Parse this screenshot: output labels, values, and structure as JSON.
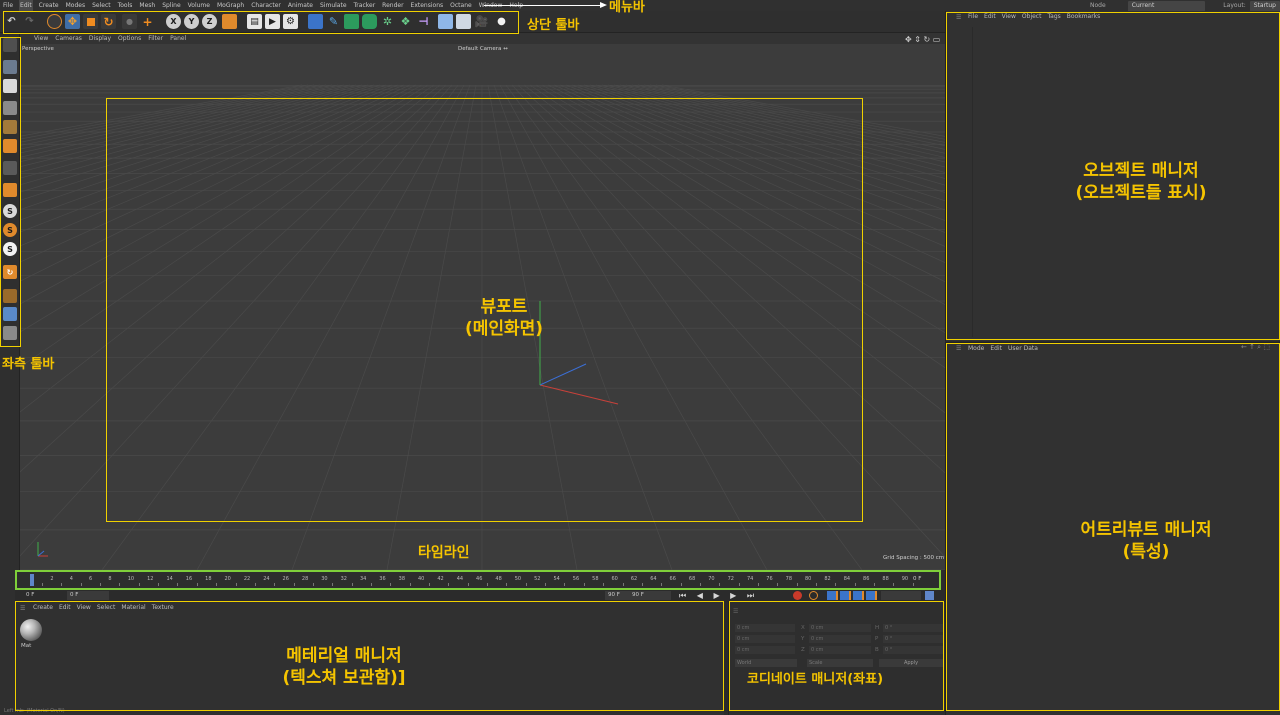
{
  "menubar": {
    "items": [
      "File",
      "Edit",
      "Create",
      "Modes",
      "Select",
      "Tools",
      "Mesh",
      "Spline",
      "Volume",
      "MoGraph",
      "Character",
      "Animate",
      "Simulate",
      "Tracker",
      "Render",
      "Extensions",
      "Octane",
      "Window",
      "Help"
    ],
    "node_space_label": "Node Space:",
    "node_space_value": "Current (Standard/Physical)",
    "layout_label": "Layout:",
    "layout_value": "Startup"
  },
  "toolbar": {
    "axis_x": "X",
    "axis_y": "Y",
    "axis_z": "Z"
  },
  "viewport": {
    "menu": [
      "View",
      "Cameras",
      "Display",
      "Options",
      "Filter",
      "Panel"
    ],
    "mode_label": "Perspective",
    "camera_label": "Default Camera ↔",
    "grid_spacing": "Grid Spacing : 500 cm"
  },
  "timeline": {
    "ticks": [
      "0",
      "2",
      "4",
      "6",
      "8",
      "10",
      "12",
      "14",
      "16",
      "18",
      "20",
      "22",
      "24",
      "26",
      "28",
      "30",
      "32",
      "34",
      "36",
      "38",
      "40",
      "42",
      "44",
      "46",
      "48",
      "50",
      "52",
      "54",
      "56",
      "58",
      "60",
      "62",
      "64",
      "66",
      "68",
      "70",
      "72",
      "74",
      "76",
      "78",
      "80",
      "82",
      "84",
      "86",
      "88",
      "90"
    ],
    "end_frame": "0 F",
    "start_field": "0 F",
    "current_field": "0 F",
    "max_field": "90 F",
    "max_field2": "90 F"
  },
  "material_manager": {
    "menu": [
      "Create",
      "Edit",
      "View",
      "Select",
      "Material",
      "Texture"
    ],
    "material_name": "Mat"
  },
  "coordinate_manager": {
    "rows": [
      {
        "axis": "X",
        "pos": "0 cm",
        "size": "0 cm",
        "rot_label": "H",
        "rot": "0 °"
      },
      {
        "axis": "Y",
        "pos": "0 cm",
        "size": "0 cm",
        "rot_label": "P",
        "rot": "0 °"
      },
      {
        "axis": "Z",
        "pos": "0 cm",
        "size": "0 cm",
        "rot_label": "B",
        "rot": "0 °"
      }
    ],
    "world_select": "World",
    "scale_select": "Scale",
    "apply_label": "Apply"
  },
  "object_manager": {
    "menu": [
      "File",
      "Edit",
      "View",
      "Object",
      "Tags",
      "Bookmarks"
    ]
  },
  "attribute_manager": {
    "menu": [
      "Mode",
      "Edit",
      "User Data"
    ]
  },
  "status_text": "Left mb: (Material On/N)",
  "annotations": {
    "menubar": "메뉴바",
    "top_toolbar": "상단 툴바",
    "left_toolbar": "좌측 툴바",
    "viewport_line1": "뷰포트",
    "viewport_line2": "(메인화면)",
    "timeline": "타임라인",
    "object_manager_line1": "오브젝트 매니저",
    "object_manager_line2": "(오브젝트들 표시)",
    "attribute_manager_line1": "어트리뷰트 매니저",
    "attribute_manager_line2": "(특성)",
    "material_manager_line1": "메테리얼 매니저",
    "material_manager_line2": "(텍스쳐 보관함)]",
    "coordinate_manager": "코디네이트 매니저(좌표)"
  },
  "colors": {
    "highlight_yellow": "#f0d100",
    "highlight_green": "#7fcf3a",
    "annotation_text": "#f5c400",
    "ui_background": "#2b2b2b",
    "viewport_background": "#3c3c3c"
  }
}
